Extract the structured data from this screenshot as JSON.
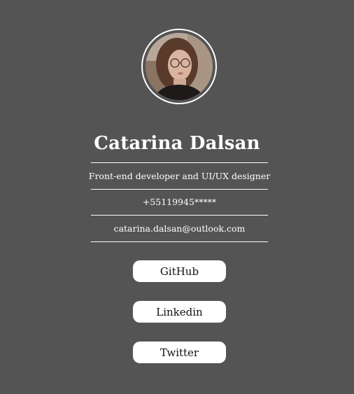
{
  "profile": {
    "name": "Catarina Dalsan",
    "role": "Front-end developer and UI/UX designer",
    "phone": "+55119945*****",
    "email": "catarina.dalsan@outlook.com"
  },
  "links": {
    "github": "GitHub",
    "linkedin": "Linkedin",
    "twitter": "Twitter"
  },
  "colors": {
    "background": "#545454",
    "text": "#ffffff",
    "button_bg": "#ffffff",
    "button_text": "#111111"
  }
}
